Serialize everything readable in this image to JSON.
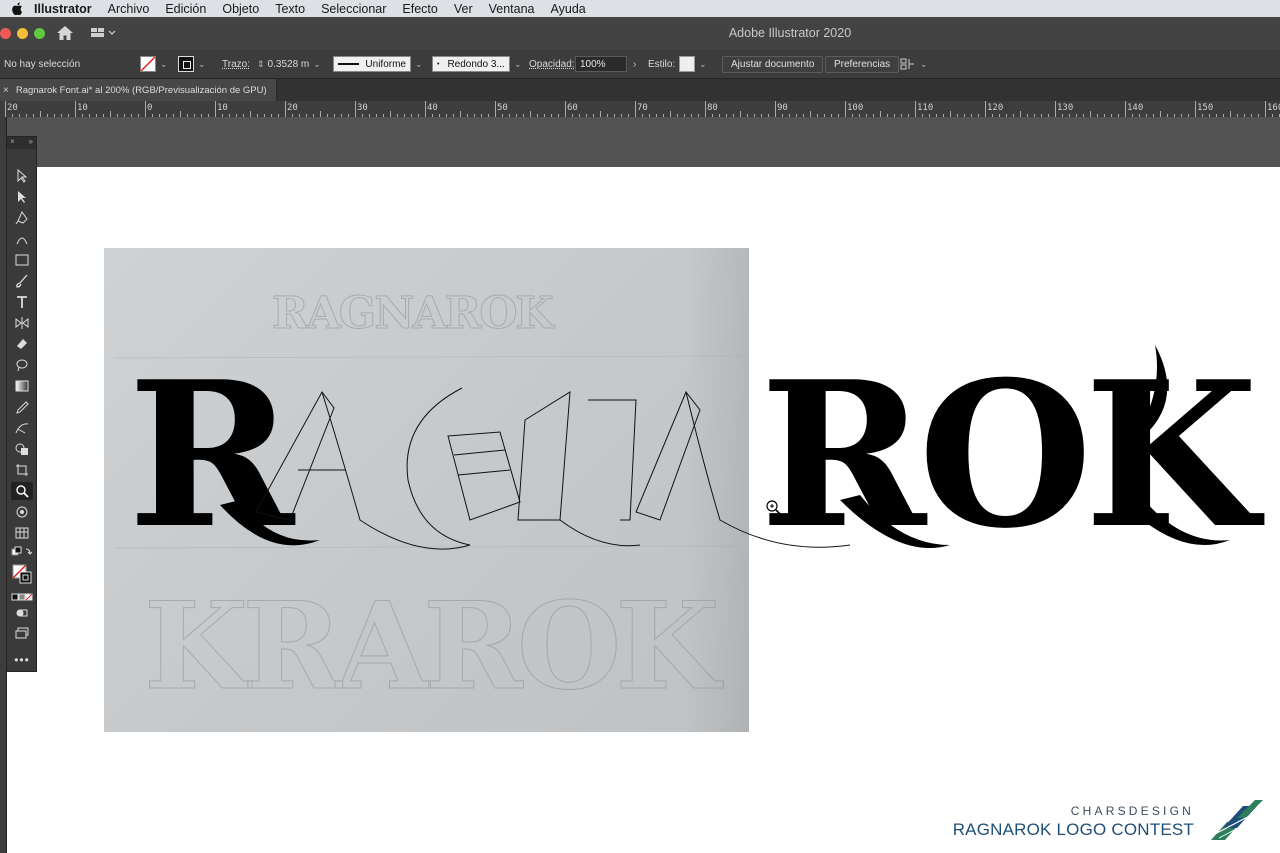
{
  "menubar": {
    "apple": "",
    "items": [
      "Illustrator",
      "Archivo",
      "Edición",
      "Objeto",
      "Texto",
      "Seleccionar",
      "Efecto",
      "Ver",
      "Ventana",
      "Ayuda"
    ]
  },
  "window": {
    "title": "Adobe Illustrator 2020"
  },
  "control_bar": {
    "selection": "No hay selección",
    "stroke_label": "Trazo:",
    "stroke_value": "0.3528 m",
    "stroke_profile": "Uniforme",
    "brush": "Redondo 3...",
    "opacity_label": "Opacidad:",
    "opacity_value": "100%",
    "style_label": "Estilo:",
    "doc_setup_button": "Ajustar documento",
    "prefs_button": "Preferencias"
  },
  "document_tab": {
    "label": "Ragnarok Font.ai* al 200% (RGB/Previsualización de GPU)",
    "close": "×"
  },
  "ruler": {
    "labels": [
      "20",
      "10",
      "0",
      "10",
      "20",
      "30",
      "40",
      "50",
      "60",
      "70",
      "80",
      "90",
      "100",
      "110",
      "120",
      "130",
      "140",
      "150",
      "160"
    ]
  },
  "artwork": {
    "solid_text": [
      "R",
      "ROK"
    ],
    "sketch_text": [
      "RAGNAROK",
      "KRAROK"
    ]
  },
  "branding": {
    "line1": "CHARSDESIGN",
    "line2": "RAGNAROK LOGO CONTEST"
  },
  "colors": {
    "accent": "#1f4e79",
    "brand_green": "#2e7d5b"
  }
}
